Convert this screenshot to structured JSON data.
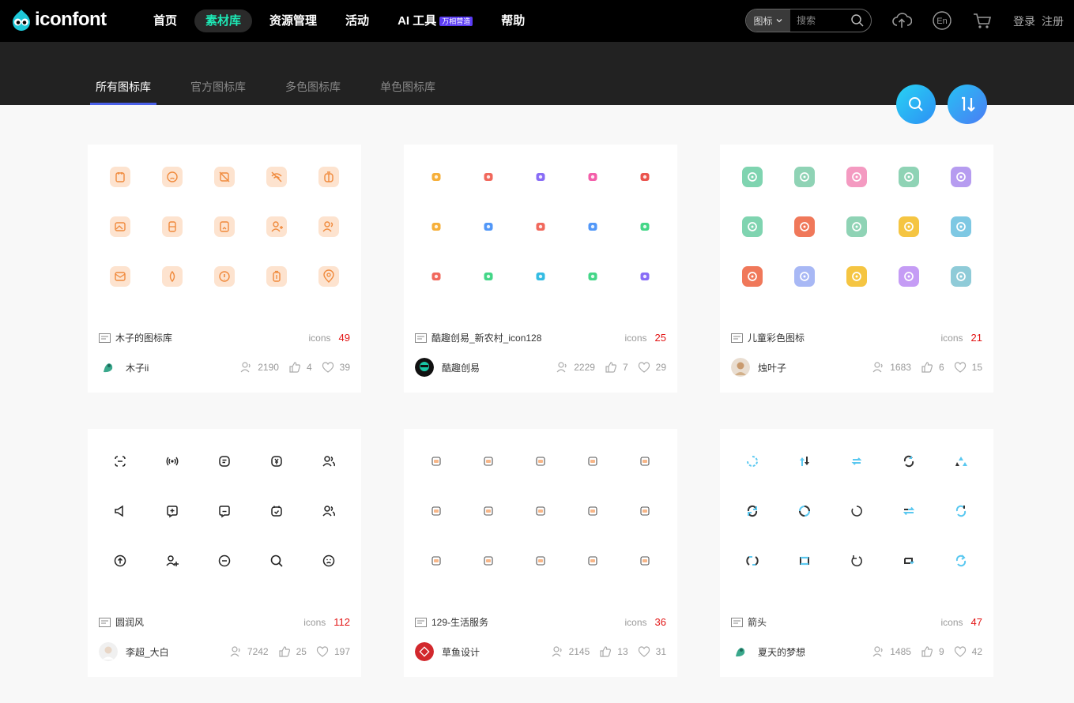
{
  "header": {
    "logo_text": "iconfont",
    "nav": [
      {
        "label": "首页"
      },
      {
        "label": "素材库",
        "active": true
      },
      {
        "label": "资源管理"
      },
      {
        "label": "活动"
      },
      {
        "label": "AI 工具",
        "badge": "万相营造"
      },
      {
        "label": "帮助"
      }
    ],
    "search": {
      "type": "图标",
      "placeholder": "搜索"
    },
    "lang_icon_text": "En",
    "login": "登录",
    "register": "注册"
  },
  "tabs": [
    {
      "label": "所有图标库",
      "active": true
    },
    {
      "label": "官方图标库"
    },
    {
      "label": "多色图标库"
    },
    {
      "label": "单色图标库"
    }
  ],
  "colors": {
    "accent": "#1de9b6",
    "tab_underline": "#4a60e8",
    "count": "#e21414"
  },
  "cards": [
    {
      "title": "木子的图标库",
      "icons_label": "icons",
      "count": "49",
      "author": "木子ii",
      "views": "2190",
      "likes": "4",
      "favs": "39",
      "style": "orange"
    },
    {
      "title": "酷趣创易_新农村_icon128",
      "icons_label": "icons",
      "count": "25",
      "author": "酷趣创易",
      "views": "2229",
      "likes": "7",
      "favs": "29",
      "style": "multi"
    },
    {
      "title": "儿童彩色图标",
      "icons_label": "icons",
      "count": "21",
      "author": "烛叶子",
      "views": "1683",
      "likes": "6",
      "favs": "15",
      "style": "pastel"
    },
    {
      "title": "圆润风",
      "icons_label": "icons",
      "count": "112",
      "author": "李超_大白",
      "views": "7242",
      "likes": "25",
      "favs": "197",
      "style": "line"
    },
    {
      "title": "129-生活服务",
      "icons_label": "icons",
      "count": "36",
      "author": "草鱼设计",
      "views": "2145",
      "likes": "13",
      "favs": "31",
      "style": "life"
    },
    {
      "title": "箭头",
      "icons_label": "icons",
      "count": "47",
      "author": "夏天的梦想",
      "views": "1485",
      "likes": "9",
      "favs": "42",
      "style": "arrow"
    }
  ]
}
